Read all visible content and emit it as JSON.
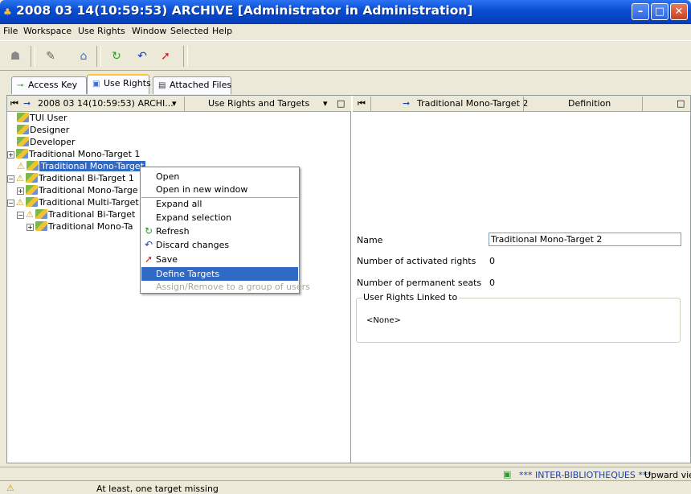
{
  "window": {
    "title": "2008 03 14(10:59:53) ARCHIVE [Administrator in Administration]",
    "minimize": "–",
    "restore": "□",
    "close": "✕"
  },
  "menu": [
    "File",
    "Workspace",
    "Use Rights",
    "Window",
    "Selected",
    "Help"
  ],
  "tabs": [
    {
      "label": "Access Key",
      "icon": "key-icon"
    },
    {
      "label": "Use Rights",
      "icon": "use-rights-icon"
    },
    {
      "label": "Attached Files",
      "icon": "document-icon"
    }
  ],
  "left_pane": {
    "header_title": "2008 03 14(10:59:53) ARCHI...",
    "header_view": "Use Rights and Targets",
    "tree": [
      {
        "label": "TUI User",
        "level": 0
      },
      {
        "label": "Designer",
        "level": 0
      },
      {
        "label": "Developer",
        "level": 0
      },
      {
        "label": "Traditional Mono-Target 1",
        "level": 0
      },
      {
        "label": "Traditional Mono-Target",
        "level": 0,
        "selected": true,
        "warning": true
      },
      {
        "label": "Traditional Bi-Target 1",
        "level": 0,
        "warning": true
      },
      {
        "label": "Traditional Mono-Targe",
        "level": 1
      },
      {
        "label": "Traditional Multi-Target 1",
        "level": 0,
        "warning": true
      },
      {
        "label": "Traditional Bi-Target",
        "level": 1,
        "warning": true
      },
      {
        "label": "Traditional Mono-Ta",
        "level": 2
      }
    ]
  },
  "context_menu": {
    "items": [
      {
        "label": "Open"
      },
      {
        "label": "Open in new window"
      },
      {
        "label": "Expand all"
      },
      {
        "label": "Expand selection"
      },
      {
        "label": "Refresh"
      },
      {
        "label": "Discard changes"
      },
      {
        "label": "Save"
      },
      {
        "label": "Define Targets"
      },
      {
        "label": "Assign/Remove to a group of users"
      }
    ]
  },
  "right_pane": {
    "header_title": "Traditional Mono-Target 2",
    "header_view": "Definition",
    "name_label": "Name",
    "name_value": "Traditional Mono-Target 2",
    "activated_label": "Number of activated rights",
    "activated_value": "0",
    "permanent_label": "Number of permanent seats",
    "permanent_value": "0",
    "group_title": "User Rights Linked to",
    "group_value": "<None>"
  },
  "status": {
    "library": "*** INTER-BIBLIOTHEQUES ***",
    "view": "Upward view",
    "message": "At least, one target missing"
  },
  "colors": {
    "selection": "#316ac5",
    "titlebar": "#0a4fd4"
  }
}
